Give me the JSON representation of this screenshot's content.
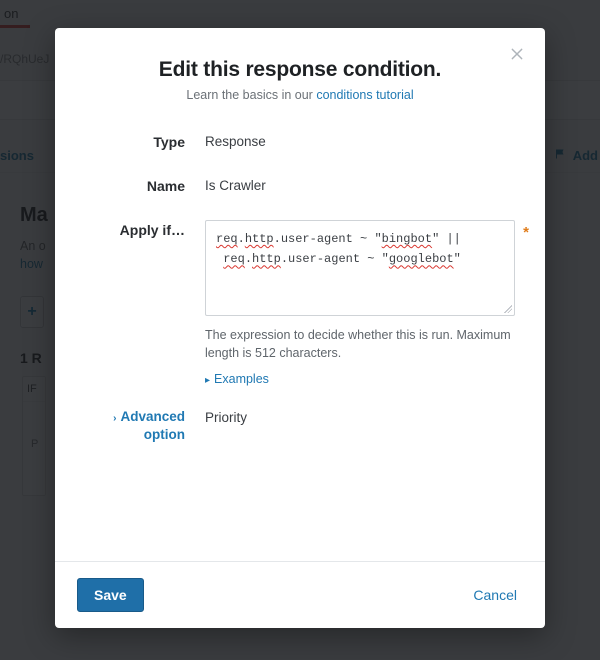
{
  "background": {
    "tab_label": "on",
    "url_fragment": "/RQhUeJ",
    "left_link": "sions",
    "add_label": "Add",
    "heading_fragment": "Ma",
    "sub_line1": "An o",
    "sub_link": "how",
    "count_label": "1 R",
    "card_if": "IF",
    "card_p": "P"
  },
  "modal": {
    "title": "Edit this response condition.",
    "subtitle_prefix": "Learn the basics in our ",
    "subtitle_link": "conditions tutorial",
    "fields": {
      "type": {
        "label": "Type",
        "value": "Response"
      },
      "name": {
        "label": "Name",
        "value": "Is Crawler"
      },
      "apply_if": {
        "label": "Apply if…",
        "value": "req.http.user-agent ~ \"bingbot\" || req.http.user-agent ~ \"googlebot\"",
        "help": "The expression to decide whether this is run. Maximum length is 512 characters.",
        "examples_label": "Examples",
        "required_marker": "*"
      },
      "advanced": {
        "toggle_label": "Advanced option",
        "value": "Priority"
      }
    },
    "buttons": {
      "save": "Save",
      "cancel": "Cancel"
    }
  }
}
